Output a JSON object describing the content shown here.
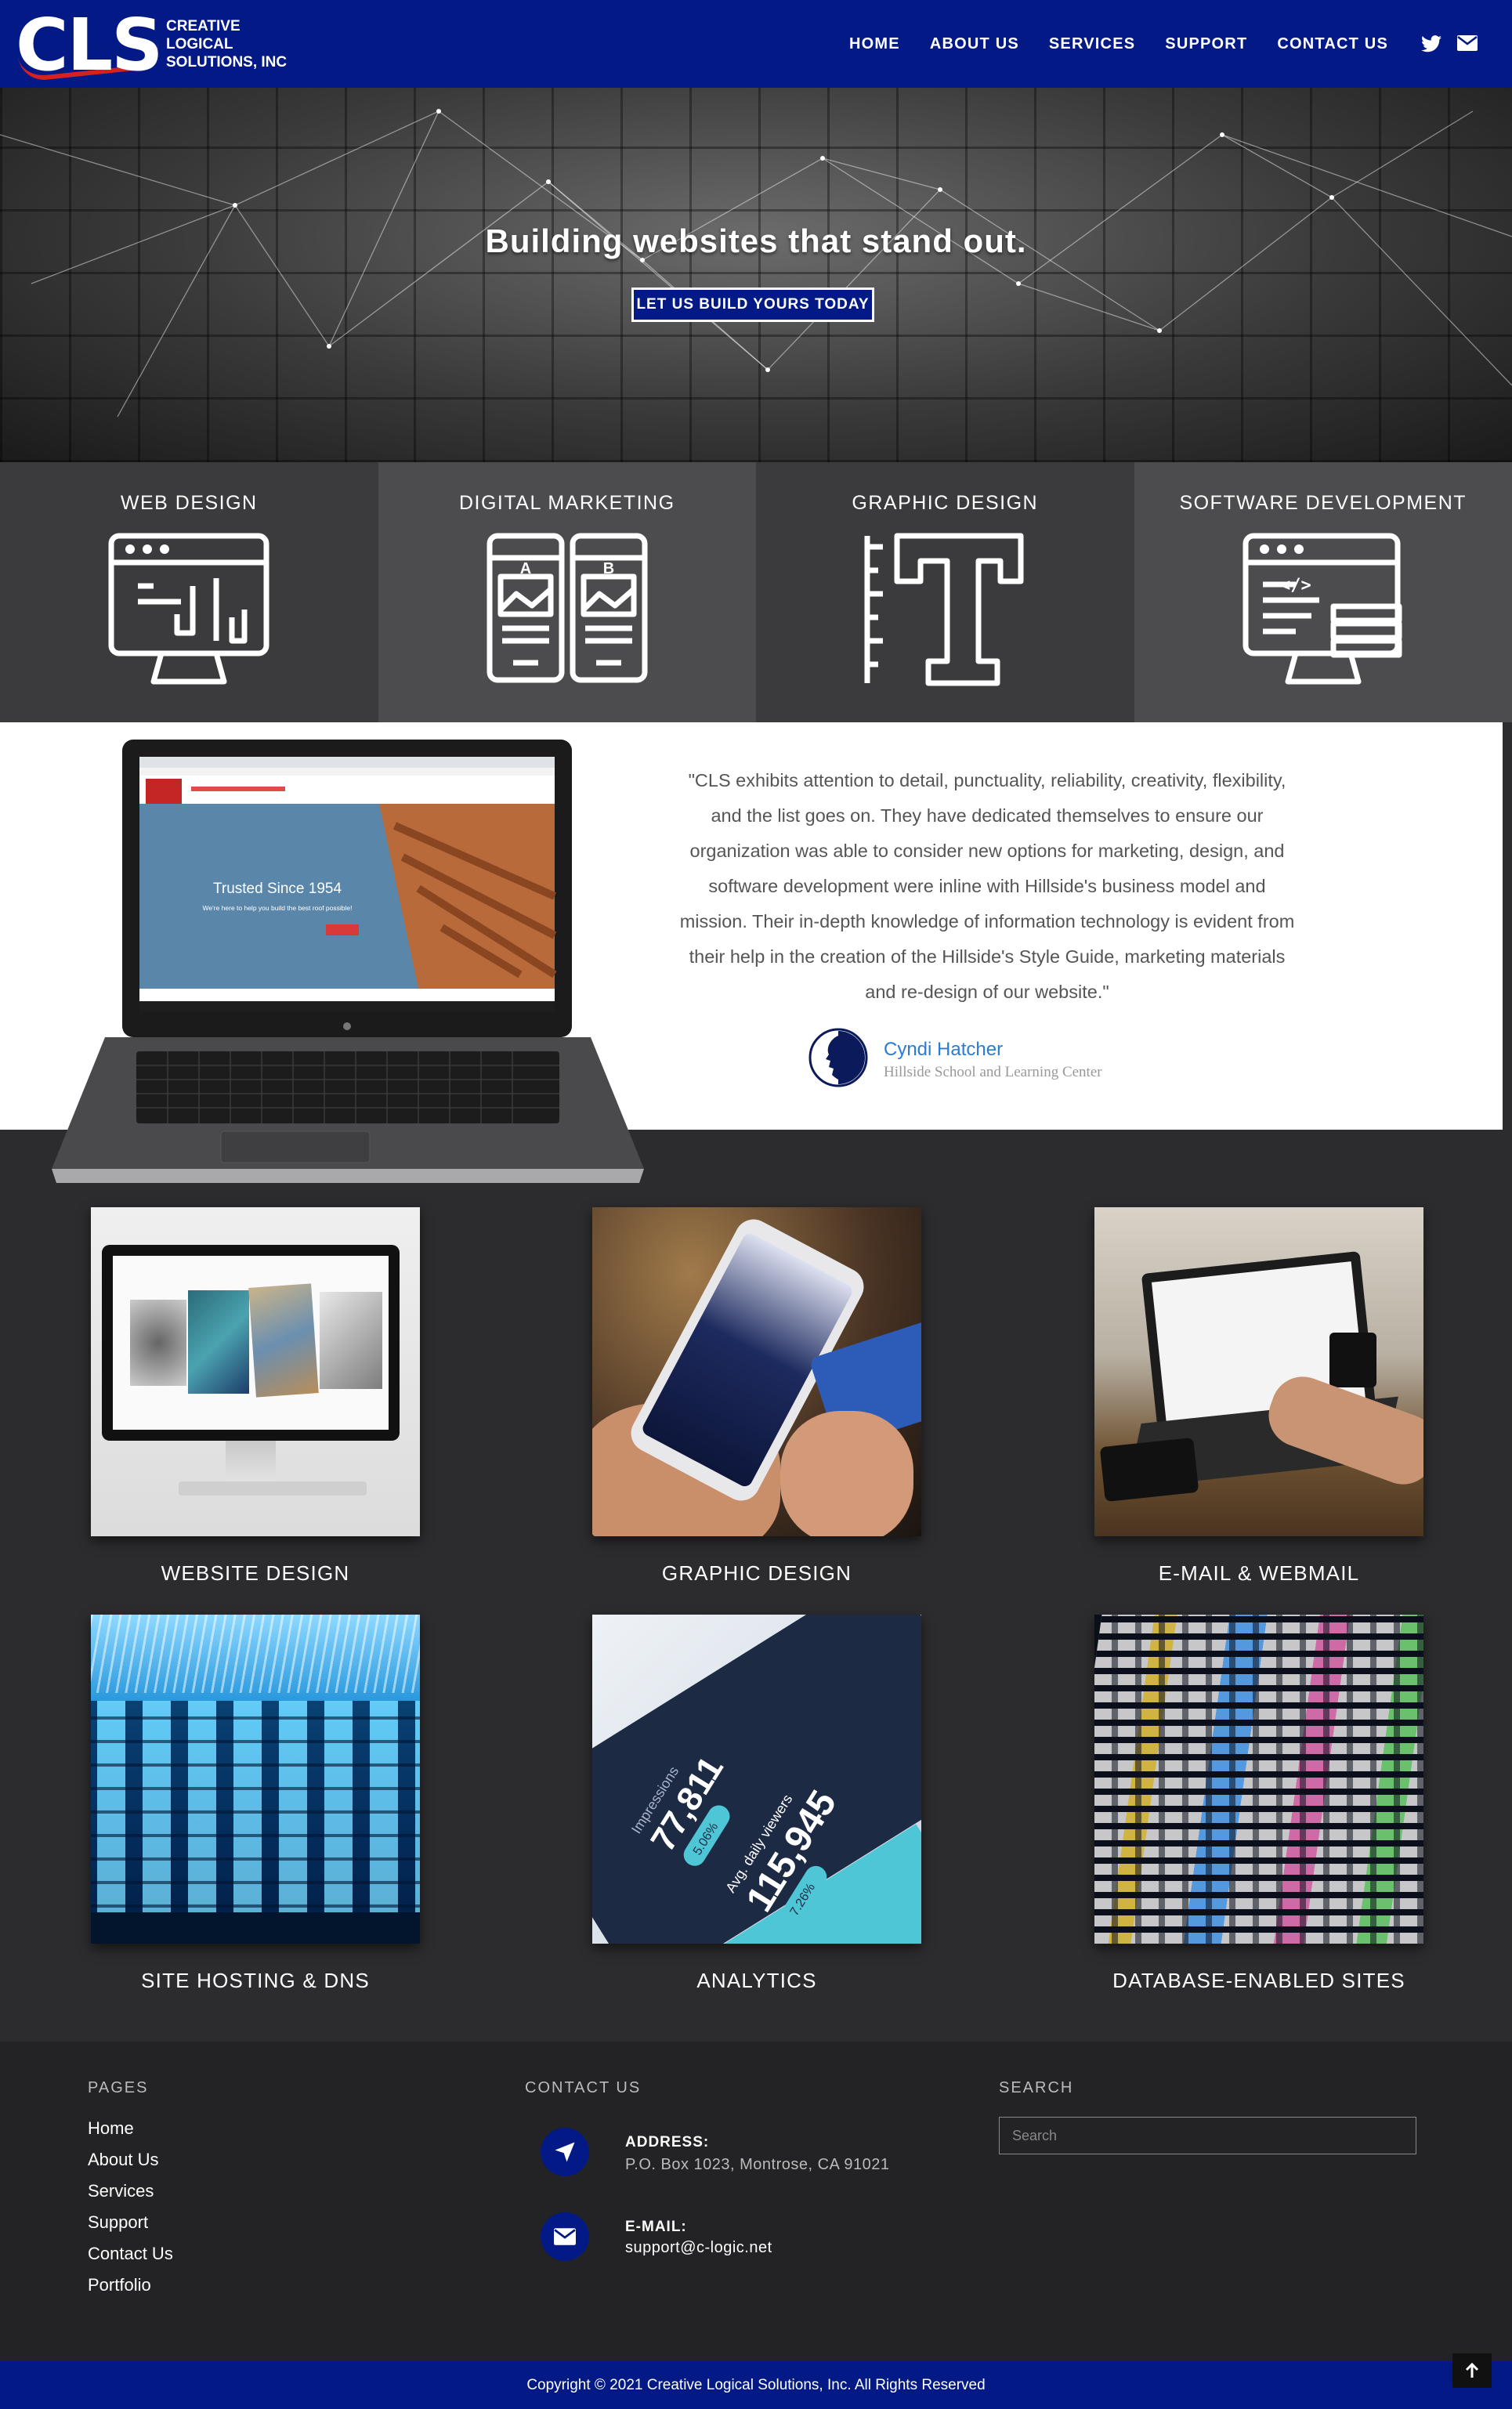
{
  "brand": {
    "logo_mark": "CLS",
    "logo_line1": "CREATIVE",
    "logo_line2": "LOGICAL",
    "logo_line3": "SOLUTIONS, INC",
    "primary_color": "#031a86",
    "accent_color": "#d42121"
  },
  "nav": {
    "items": [
      "HOME",
      "ABOUT US",
      "SERVICES",
      "SUPPORT",
      "CONTACT US"
    ],
    "icons": [
      "twitter-icon",
      "envelope-icon"
    ]
  },
  "hero": {
    "title": "Building websites that stand out.",
    "cta": "LET US BUILD YOURS TODAY"
  },
  "services_band": [
    {
      "label": "WEB DESIGN",
      "icon": "web-design-icon"
    },
    {
      "label": "DIGITAL MARKETING",
      "icon": "ab-testing-icon"
    },
    {
      "label": "GRAPHIC DESIGN",
      "icon": "typography-icon"
    },
    {
      "label": "SOFTWARE DEVELOPMENT",
      "icon": "code-monitor-icon"
    }
  ],
  "laptop_screen": {
    "headline": "Trusted Since 1954",
    "subline": "We're here to help you build the best roof possible!"
  },
  "testimonial": {
    "quote": "\"CLS exhibits attention to detail, punctuality, reliability, creativity, flexibility, and the list goes on. They have dedicated themselves to ensure our organization was able to consider new options for marketing, design, and software development were inline with Hillside's business model and mission. Their in-depth knowledge of information technology is evident from their help in the creation of the Hillside's Style Guide, marketing materials and re-design of our website.\"",
    "author": "Cyndi Hatcher",
    "organization": "Hillside School and Learning Center"
  },
  "portfolio": [
    {
      "label": "WEBSITE DESIGN"
    },
    {
      "label": "GRAPHIC DESIGN"
    },
    {
      "label": "E-MAIL & WEBMAIL"
    },
    {
      "label": "SITE HOSTING & DNS"
    },
    {
      "label": "ANALYTICS"
    },
    {
      "label": "DATABASE-ENABLED SITES"
    }
  ],
  "analytics_image": {
    "impressions_value": "77,811",
    "impressions_label": "Impressions",
    "impressions_delta": "5.06%",
    "viewers_label": "Avg. daily viewers",
    "viewers_value": "115,945",
    "viewers_delta": "7.26%"
  },
  "footer": {
    "pages_heading": "PAGES",
    "pages": [
      "Home",
      "About Us",
      "Services",
      "Support",
      "Contact Us",
      "Portfolio"
    ],
    "contact_heading": "CONTACT US",
    "address_label": "ADDRESS:",
    "address_value": "P.O. Box 1023, Montrose, CA 91021",
    "email_label": "E-MAIL:",
    "email_value": "support@c-logic.net",
    "search_heading": "SEARCH",
    "search_placeholder": "Search",
    "copyright": "Copyright © 2021 Creative Logical Solutions, Inc. All Rights Reserved"
  }
}
